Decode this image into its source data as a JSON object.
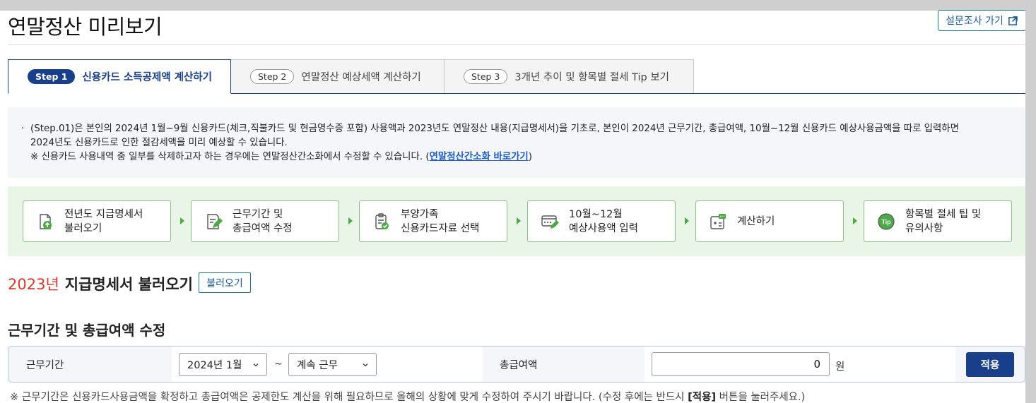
{
  "header": {
    "title": "연말정산 미리보기",
    "survey_label": "설문조사 가기"
  },
  "tabs": [
    {
      "step": "Step 1",
      "label": "신용카드 소득공제액 계산하기",
      "active": true
    },
    {
      "step": "Step 2",
      "label": "연말정산 예상세액 계산하기",
      "active": false
    },
    {
      "step": "Step 3",
      "label": "3개년 추이 및 항목별 절세 Tip 보기",
      "active": false
    }
  ],
  "notice": {
    "line1": "(Step.01)은 본인의 2024년 1월~9월 신용카드(체크,직불카드 및 현금영수증 포함) 사용액과 2023년도 연말정산 내용(지급명세서)을 기초로, 본인이 2024년 근무기간, 총급여액, 10월~12월 신용카드 예상사용금액을 따로 입력하면",
    "line2": "2024년도 신용카드로 인한 절감세액을 미리 예상할 수 있습니다.",
    "line3_prefix": "※ 신용카드 사용내역 중 일부를 삭제하고자 하는 경우에는 연말정산간소화에서 수정할 수 있습니다. (",
    "line3_link": "연말정산간소화 바로가기",
    "line3_suffix": ")"
  },
  "process": [
    {
      "line1": "전년도 지급명세서",
      "line2": "불러오기",
      "icon": "doc-upload-icon"
    },
    {
      "line1": "근무기간 및",
      "line2": "총급여액 수정",
      "icon": "doc-edit-icon"
    },
    {
      "line1": "부양가족",
      "line2": "신용카드자료 선택",
      "icon": "clipboard-check-icon"
    },
    {
      "line1": "10월~12월",
      "line2": "예상사용액 입력",
      "icon": "card-edit-icon"
    },
    {
      "line1": "계산하기",
      "line2": "",
      "icon": "calculator-icon"
    },
    {
      "line1": "항목별 절세 팁 및",
      "line2": "유의사항",
      "icon": "tip-icon"
    }
  ],
  "section1": {
    "year": "2023년",
    "title": "지급명세서 불러오기",
    "button": "불러오기"
  },
  "section2": {
    "title": "근무기간 및 총급여액 수정"
  },
  "form": {
    "period_label": "근무기간",
    "start_select": "2024년 1월",
    "tilde": "~",
    "end_select": "계속 근무",
    "salary_label": "총급여액",
    "salary_value": "0",
    "unit": "원",
    "apply": "적용"
  },
  "footnote": {
    "prefix": "※ 근무기간은 신용카드사용금액을 확정하고 총급여액은 공제한도 계산을 위해 필요하므로 올해의 상황에 맞게 수정하여 주시기 바랍니다. (수정 후에는 반드시 ",
    "bold": "[적용]",
    "suffix": " 버튼을 눌러주세요.)"
  },
  "colors": {
    "primary": "#1a3f8a",
    "accent_red": "#d63a2c",
    "process_bg": "#e9f5e6",
    "process_green": "#4aaa44"
  }
}
